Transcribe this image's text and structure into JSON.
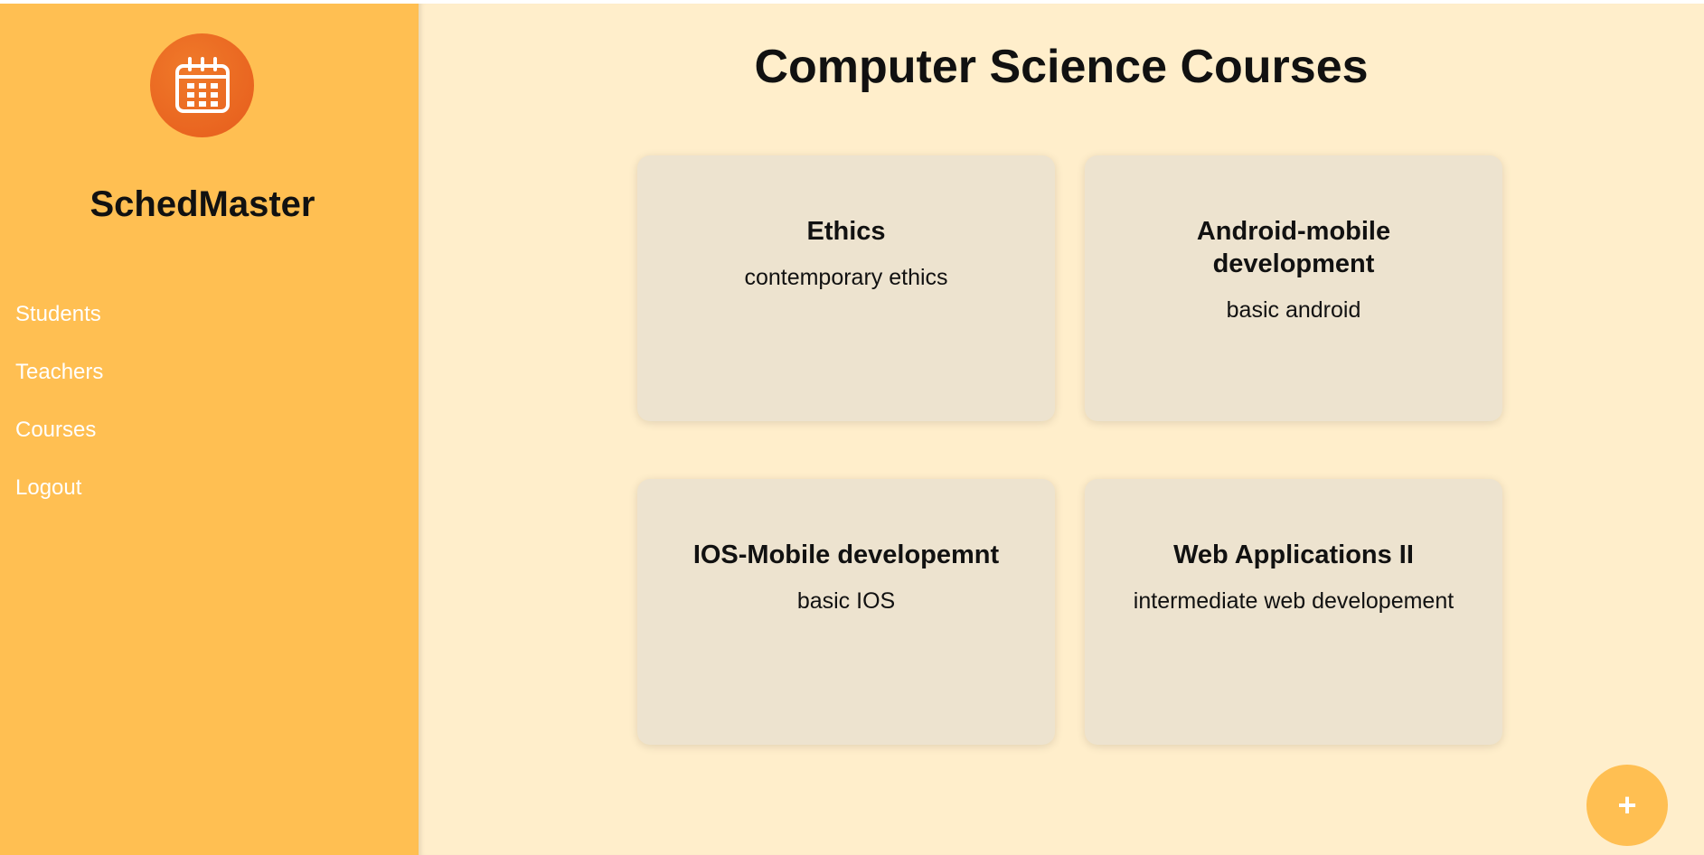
{
  "sidebar": {
    "logo_icon": "calendar-icon",
    "brand": "SchedMaster",
    "nav": [
      {
        "label": "Students"
      },
      {
        "label": "Teachers"
      },
      {
        "label": "Courses"
      },
      {
        "label": "Logout"
      }
    ]
  },
  "main": {
    "title": "Computer Science Courses",
    "courses": [
      {
        "title": "Ethics",
        "description": "contemporary ethics"
      },
      {
        "title": "Android-mobile development",
        "description": "basic android"
      },
      {
        "title": "IOS-Mobile developemnt",
        "description": "basic IOS"
      },
      {
        "title": "Web Applications II",
        "description": "intermediate web developement"
      }
    ],
    "fab_label": "+"
  },
  "colors": {
    "sidebar": "#ffbf52",
    "main_bg": "#ffeecb",
    "card_bg": "#ede3cf",
    "logo": "#e65c1c"
  }
}
